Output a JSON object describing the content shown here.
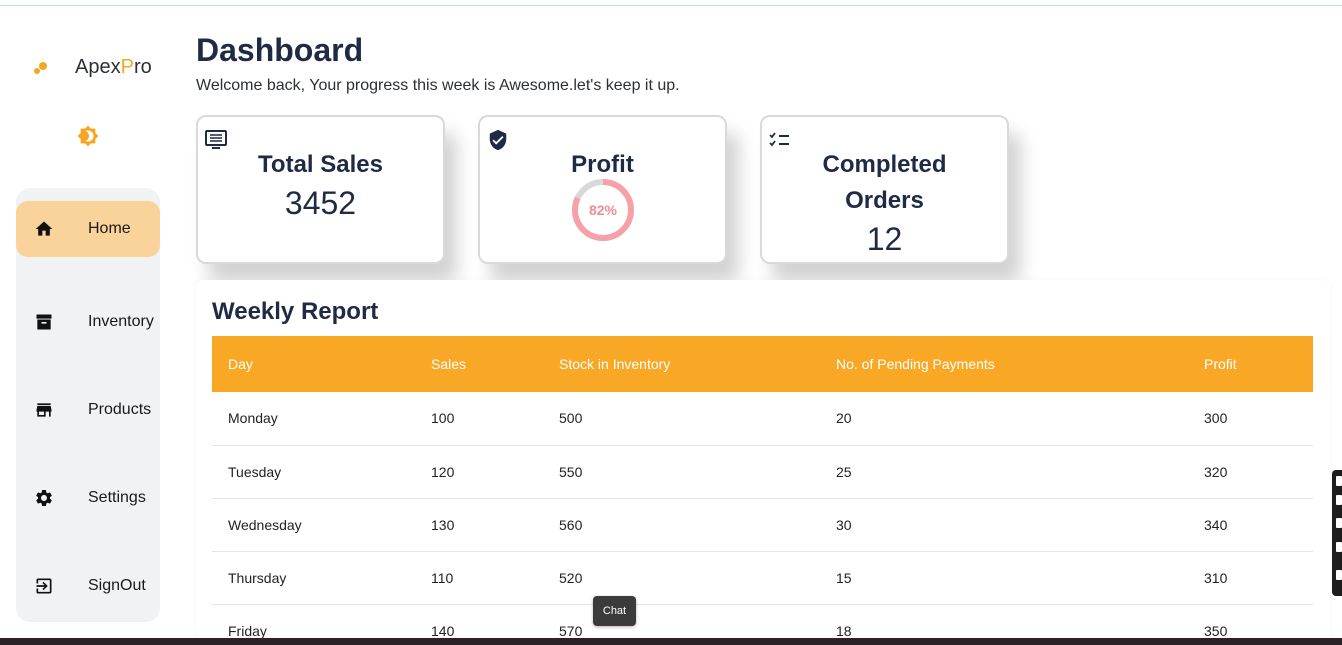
{
  "brand": {
    "name_prefix": "Apex",
    "name_accent": "P",
    "name_suffix": "ro",
    "accent_color": "#f6a623"
  },
  "sidebar": {
    "items": [
      {
        "label": "Home",
        "icon": "home-icon",
        "active": true
      },
      {
        "label": "Inventory",
        "icon": "archive-icon",
        "active": false
      },
      {
        "label": "Products",
        "icon": "store-icon",
        "active": false
      },
      {
        "label": "Settings",
        "icon": "gear-icon",
        "active": false
      },
      {
        "label": "SignOut",
        "icon": "sign-out-icon",
        "active": false
      }
    ]
  },
  "header": {
    "title": "Dashboard",
    "subtitle": "Welcome back, Your progress this week is Awesome.let's keep it up."
  },
  "cards": {
    "total_sales": {
      "title": "Total Sales",
      "value": "3452",
      "icon": "monitor-list-icon"
    },
    "profit": {
      "title": "Profit",
      "percent_label": "82%",
      "percent": 82,
      "icon": "shield-check-icon",
      "ring_color": "#f6a0a8"
    },
    "completed_orders": {
      "title": "Completed Orders",
      "value": "12",
      "icon": "checklist-icon"
    }
  },
  "report": {
    "title": "Weekly Report",
    "header_color": "#f9a826",
    "columns": [
      "Day",
      "Sales",
      "Stock in Inventory",
      "No. of Pending Payments",
      "Profit"
    ],
    "rows": [
      [
        "Monday",
        "100",
        "500",
        "20",
        "300"
      ],
      [
        "Tuesday",
        "120",
        "550",
        "25",
        "320"
      ],
      [
        "Wednesday",
        "130",
        "560",
        "30",
        "340"
      ],
      [
        "Thursday",
        "110",
        "520",
        "15",
        "310"
      ],
      [
        "Friday",
        "140",
        "570",
        "18",
        "350"
      ]
    ]
  },
  "chat": {
    "label": "Chat"
  }
}
